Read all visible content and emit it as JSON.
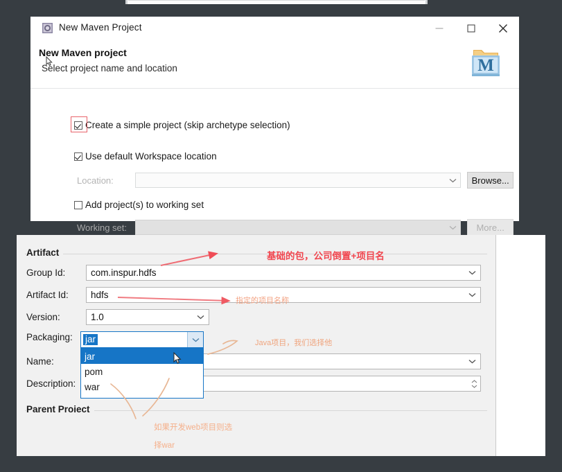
{
  "window": {
    "title": "New Maven Project",
    "icon": "maven-window-icon",
    "controls": {
      "minimize": "minimize",
      "maximize": "maximize",
      "close": "close"
    }
  },
  "wizard_header": {
    "title": "New Maven project",
    "subtitle": "Select project name and location",
    "logo": "maven-folder-logo",
    "logo_letter": "M"
  },
  "options": {
    "simple_project": {
      "label": "Create a simple project (skip archetype selection)",
      "checked": true,
      "highlighted": true
    },
    "default_workspace": {
      "label": "Use default Workspace location",
      "checked": true
    },
    "location": {
      "label": "Location:",
      "value": "",
      "placeholder": "",
      "disabled": true
    },
    "browse_button": "Browse...",
    "working_set_checkbox": {
      "label": "Add project(s) to working set",
      "checked": false
    },
    "working_set": {
      "label": "Working set:",
      "value": "",
      "disabled": true
    },
    "more_button": "More..."
  },
  "artifact": {
    "group_title": "Artifact",
    "fields": [
      {
        "label": "Group Id:",
        "value": "com.inspur.hdfs",
        "control": "combo"
      },
      {
        "label": "Artifact Id:",
        "value": "hdfs",
        "control": "combo"
      },
      {
        "label": "Version:",
        "value": "1.0",
        "control": "combo-short"
      },
      {
        "label": "Packaging:",
        "value": "jar",
        "control": "combo-open"
      },
      {
        "label": "Name:",
        "value": "",
        "control": "combo"
      },
      {
        "label": "Description:",
        "value": "",
        "control": "spinner"
      }
    ],
    "packaging_options": [
      "jar",
      "pom",
      "war"
    ],
    "packaging_selected": "jar",
    "parent_group_title": "Parent Proiect"
  },
  "annotations": [
    {
      "id": "ann-group-id",
      "text": "基础的包，公司倒置+项目名",
      "color": "#f1464f"
    },
    {
      "id": "ann-artifact-id",
      "text": "指定的项目名称",
      "color": "#f4a07e"
    },
    {
      "id": "ann-packaging",
      "text": "Java项目，我们选择他",
      "color": "#f0a57e"
    },
    {
      "id": "ann-war-1",
      "text": "如果开发web项目则选",
      "color": "#f5b08b"
    },
    {
      "id": "ann-war-2",
      "text": "择war",
      "color": "#f5b08b"
    }
  ],
  "colors": {
    "backdrop": "#373d42",
    "dialog_bg": "#ffffff",
    "panel_bg": "#f1f1f1",
    "accent_blue": "#1675c6",
    "highlight_red": "#e8636a",
    "annotation_red": "#f1464f",
    "annotation_orange": "#f0a57e"
  }
}
